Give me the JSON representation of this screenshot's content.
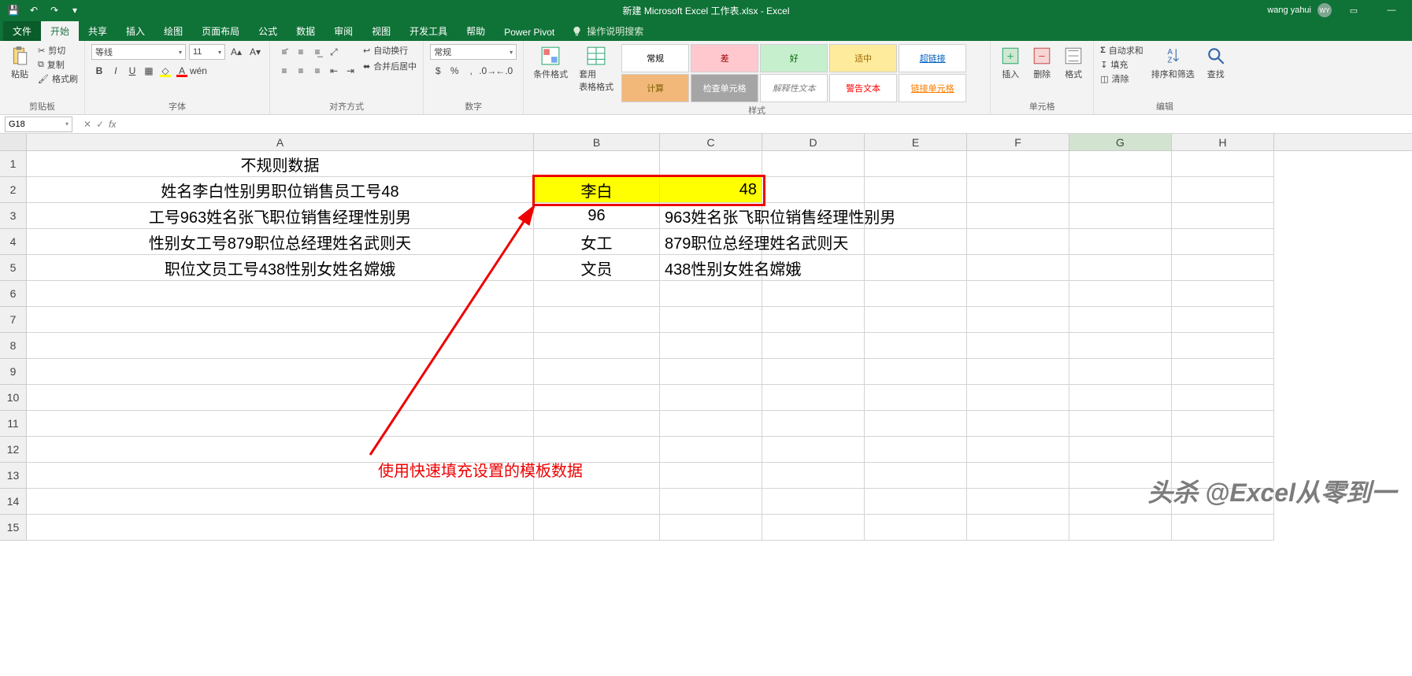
{
  "title": "新建 Microsoft Excel 工作表.xlsx - Excel",
  "user": {
    "name": "wang yahui",
    "initials": "WY"
  },
  "tabs": {
    "file": "文件",
    "items": [
      "开始",
      "共享",
      "插入",
      "绘图",
      "页面布局",
      "公式",
      "数据",
      "审阅",
      "视图",
      "开发工具",
      "帮助",
      "Power Pivot"
    ],
    "active": 0,
    "tell_me": "操作说明搜索"
  },
  "ribbon": {
    "clipboard": {
      "label": "剪贴板",
      "paste": "粘贴",
      "cut": "剪切",
      "copy": "复制",
      "painter": "格式刷"
    },
    "font": {
      "label": "字体",
      "name": "等线",
      "size": "11"
    },
    "align": {
      "label": "对齐方式",
      "wrap": "自动换行",
      "merge": "合并后居中"
    },
    "number": {
      "label": "数字",
      "format": "常规"
    },
    "styles": {
      "label": "样式",
      "cond": "条件格式",
      "table": "套用\n表格格式",
      "items": [
        {
          "t": "常规",
          "bg": "#ffffff",
          "fg": "#000"
        },
        {
          "t": "差",
          "bg": "#ffc7ce",
          "fg": "#9c0006"
        },
        {
          "t": "好",
          "bg": "#c6efce",
          "fg": "#006100"
        },
        {
          "t": "适中",
          "bg": "#ffeb9c",
          "fg": "#9c6500"
        },
        {
          "t": "超链接",
          "bg": "#fff",
          "fg": "#0563c1",
          "u": true
        },
        {
          "t": "计算",
          "bg": "#f2b87a",
          "fg": "#7f6000"
        },
        {
          "t": "检查单元格",
          "bg": "#a5a5a5",
          "fg": "#fff"
        },
        {
          "t": "解释性文本",
          "bg": "#fff",
          "fg": "#7f7f7f",
          "i": true
        },
        {
          "t": "警告文本",
          "bg": "#fff",
          "fg": "#ff0000"
        },
        {
          "t": "链接单元格",
          "bg": "#fff",
          "fg": "#fa7d00",
          "u": true
        }
      ]
    },
    "cells": {
      "label": "单元格",
      "insert": "插入",
      "delete": "删除",
      "format": "格式"
    },
    "editing": {
      "label": "编辑",
      "sum": "自动求和",
      "fill": "填充",
      "clear": "清除",
      "sort": "排序和筛选",
      "find": "查找"
    }
  },
  "namebox": "G18",
  "formula": "",
  "cols": [
    "A",
    "B",
    "C",
    "D",
    "E",
    "F",
    "G",
    "H"
  ],
  "rowcount": 15,
  "cells": {
    "A1": "不规则数据",
    "A2": "姓名李白性别男职位销售员工号48",
    "A3": "工号963姓名张飞职位销售经理性别男",
    "A4": "性别女工号879职位总经理姓名武则天",
    "A5": "职位文员工号438性别女姓名嫦娥",
    "B2": "李白",
    "C2": "48",
    "B3": "96",
    "C3": "963姓名张飞职位销售经理性别男",
    "B4": "女工",
    "C4": "879职位总经理姓名武则天",
    "B5": "文员",
    "C5": "438性别女姓名嫦娥"
  },
  "highlight": [
    "B2",
    "C2"
  ],
  "annotation": "使用快速填充设置的模板数据",
  "watermark": "头杀 @Excel从零到一"
}
